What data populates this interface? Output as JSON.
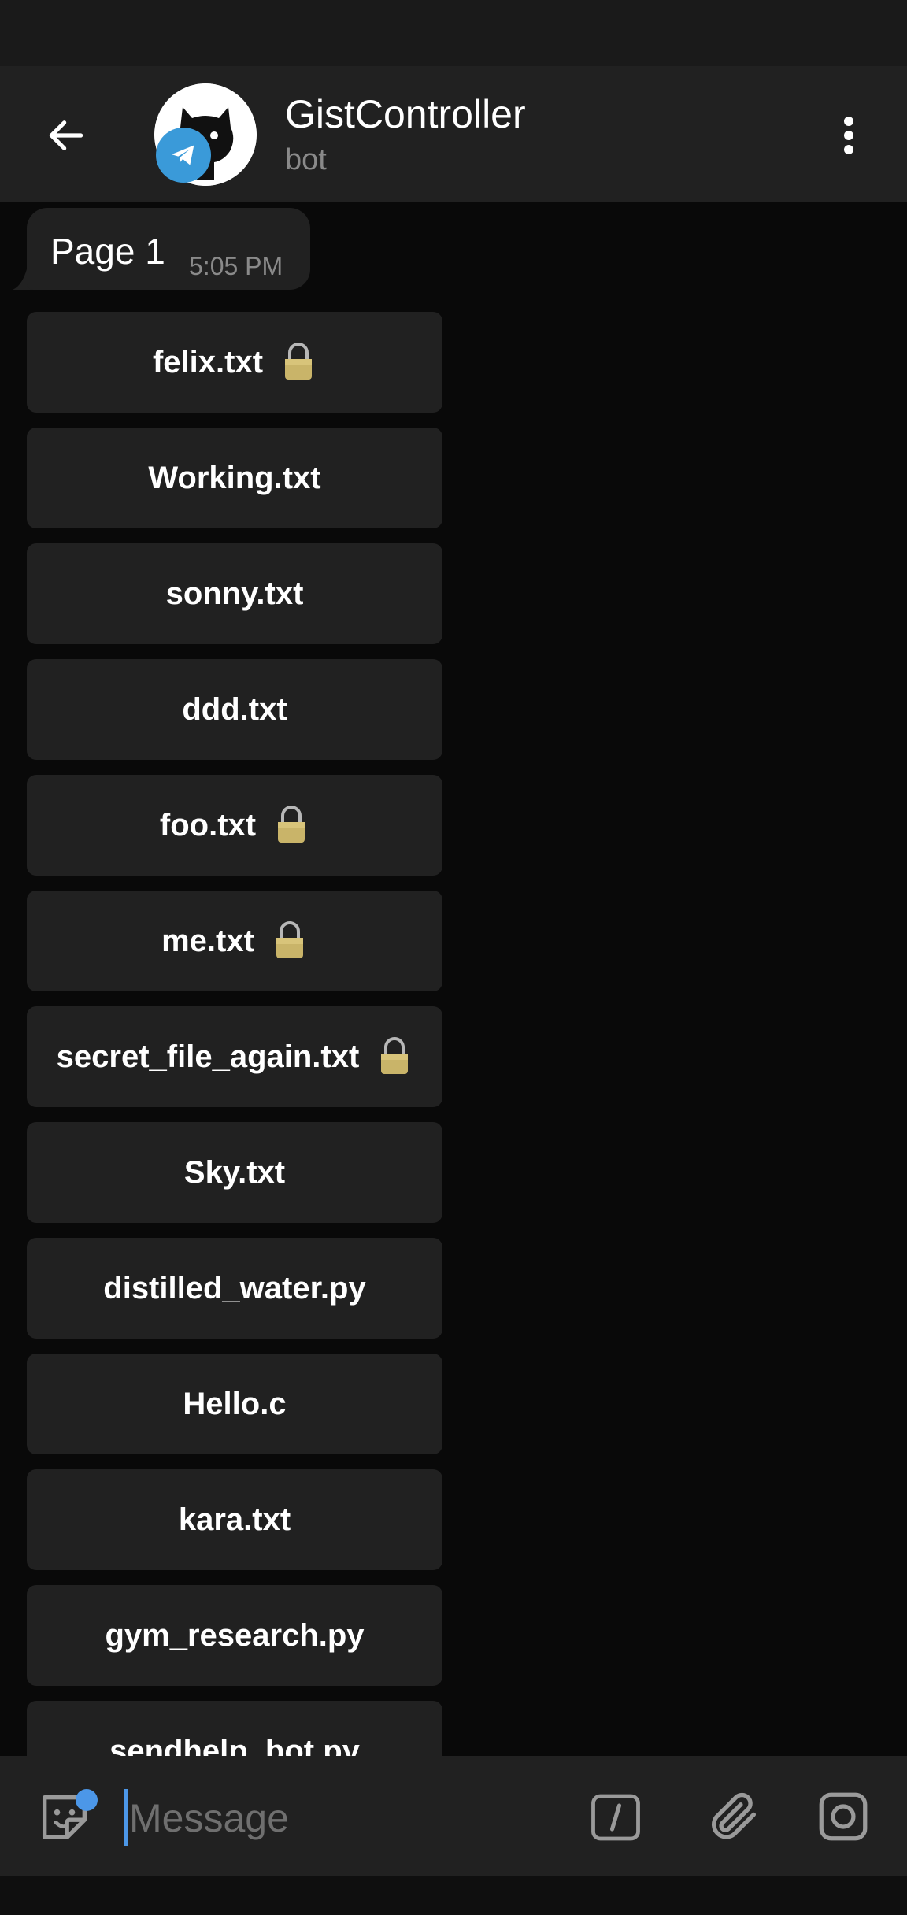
{
  "header": {
    "title": "GistController",
    "subtitle": "bot",
    "back_icon": "arrow-left-icon",
    "menu_icon": "more-vertical-icon"
  },
  "message": {
    "text": "Page 1",
    "time": "5:05 PM"
  },
  "keyboard": [
    {
      "label": "felix.txt",
      "locked": true
    },
    {
      "label": "Working.txt",
      "locked": false
    },
    {
      "label": "sonny.txt",
      "locked": false
    },
    {
      "label": "ddd.txt",
      "locked": false
    },
    {
      "label": "foo.txt",
      "locked": true
    },
    {
      "label": "me.txt",
      "locked": true
    },
    {
      "label": "secret_file_again.txt",
      "locked": true
    },
    {
      "label": "Sky.txt",
      "locked": false
    },
    {
      "label": "distilled_water.py",
      "locked": false
    },
    {
      "label": "Hello.c",
      "locked": false
    },
    {
      "label": "kara.txt",
      "locked": false
    },
    {
      "label": "gym_research.py",
      "locked": false
    },
    {
      "label": "sendhelp_bot.py",
      "locked": false
    }
  ],
  "input": {
    "placeholder": "Message"
  },
  "colors": {
    "background": "#090909",
    "surface": "#212121",
    "accent": "#4c97e8",
    "telegram_badge": "#3a9ad9"
  }
}
